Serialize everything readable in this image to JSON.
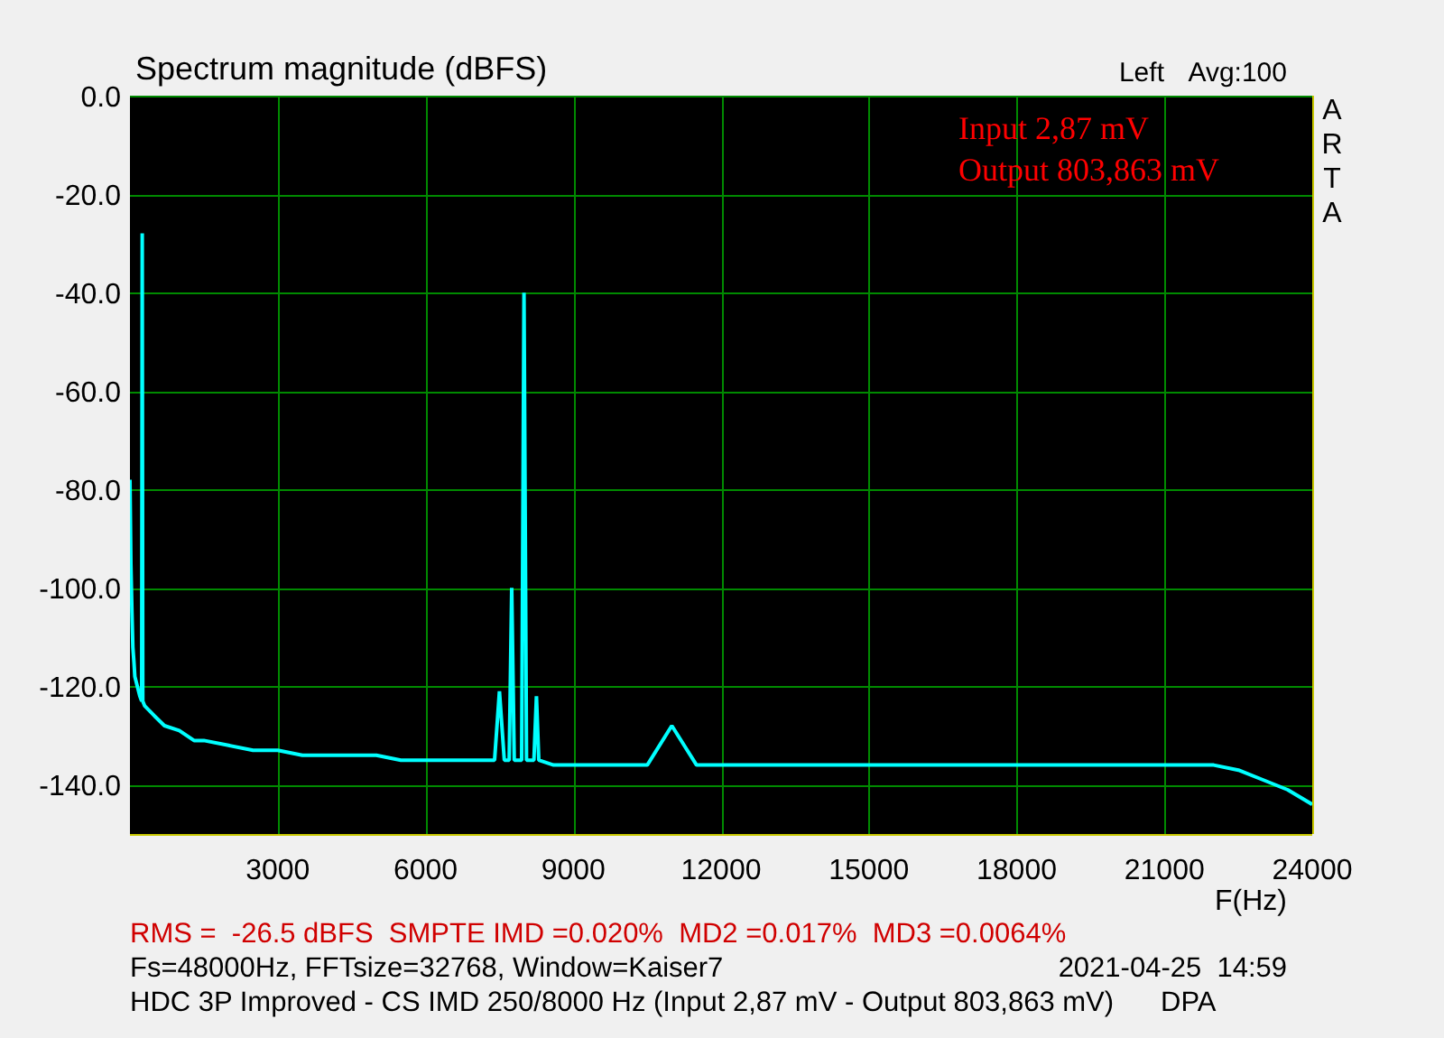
{
  "header": {
    "averaging": "Avg:100"
  },
  "brand": "ARTA",
  "chart_data": {
    "type": "line",
    "title": "Spectrum magnitude (dBFS)",
    "xlabel": "F(Hz)",
    "grid": true,
    "xlim": [
      0,
      24000
    ],
    "ylim": [
      -150,
      0
    ],
    "xticks": [
      3000,
      6000,
      9000,
      12000,
      15000,
      18000,
      21000,
      24000
    ],
    "yticks": [
      {
        "value": 0,
        "label": "0.0"
      },
      {
        "value": -20,
        "label": "-20.0"
      },
      {
        "value": -40,
        "label": "-40.0"
      },
      {
        "value": -60,
        "label": "-60.0"
      },
      {
        "value": -80,
        "label": "-80.0"
      },
      {
        "value": -100,
        "label": "-100.0"
      },
      {
        "value": -120,
        "label": "-120.0"
      },
      {
        "value": -140,
        "label": "-140.0"
      }
    ],
    "x": [
      0,
      20,
      40,
      60,
      80,
      100,
      150,
      200,
      240,
      250,
      260,
      300,
      400,
      500,
      700,
      1000,
      1300,
      1500,
      2000,
      2500,
      3000,
      3500,
      4000,
      4500,
      5000,
      5500,
      6000,
      6500,
      7000,
      7400,
      7500,
      7600,
      7700,
      7750,
      7800,
      7950,
      8000,
      8050,
      8200,
      8250,
      8300,
      8600,
      9000,
      9500,
      10000,
      10500,
      11000,
      11500,
      12000,
      12500,
      13000,
      13500,
      14000,
      14500,
      15000,
      15500,
      16000,
      16500,
      17000,
      17500,
      18000,
      18500,
      19000,
      19500,
      20000,
      20500,
      21000,
      21500,
      22000,
      22500,
      23000,
      23500,
      24000
    ],
    "series": [
      {
        "name": "Left",
        "color": "#00ffff",
        "values": [
          -78,
          -95,
          -105,
          -112,
          -115,
          -118,
          -120,
          -122,
          -123,
          -28,
          -123,
          -124,
          -125,
          -126,
          -128,
          -129,
          -131,
          -131,
          -132,
          -133,
          -133,
          -134,
          -134,
          -134,
          -134,
          -135,
          -135,
          -135,
          -135,
          -135,
          -121,
          -135,
          -135,
          -100,
          -135,
          -135,
          -40,
          -135,
          -135,
          -122,
          -135,
          -136,
          -136,
          -136,
          -136,
          -136,
          -128,
          -136,
          -136,
          -136,
          -136,
          -136,
          -136,
          -136,
          -136,
          -136,
          -136,
          -136,
          -136,
          -136,
          -136,
          -136,
          -136,
          -136,
          -136,
          -136,
          -136,
          -136,
          -136,
          -137,
          -139,
          -141,
          -144
        ]
      }
    ],
    "annotations": [
      {
        "text": "Input 2,87 mV"
      },
      {
        "text": "Output 803,863 mV"
      }
    ]
  },
  "info_lines": [
    {
      "kind": "result",
      "text": "RMS =  -26.5 dBFS  SMPTE IMD =0.020%  MD2 =0.017%  MD3 =0.0064%"
    },
    {
      "kind": "settings",
      "text": "Fs=48000Hz, FFTsize=32768, Window=Kaiser7",
      "aside": "2021-04-25  14:59"
    },
    {
      "kind": "caption",
      "text": "HDC 3P Improved - CS IMD 250/8000 Hz (Input 2,87 mV - Output 803,863 mV)",
      "aside": "DPA"
    }
  ]
}
